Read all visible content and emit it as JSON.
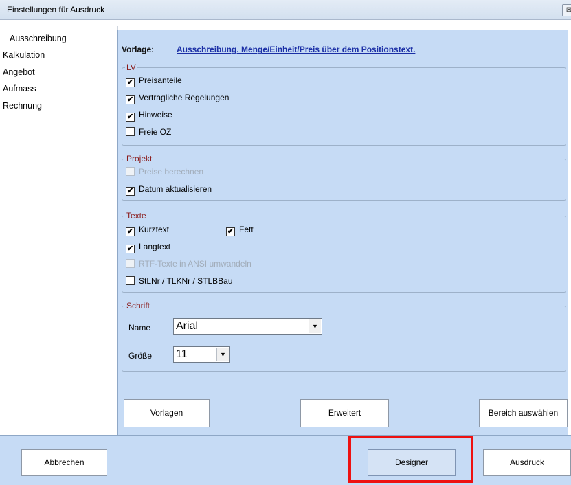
{
  "window": {
    "title": "Einstellungen für Ausdruck",
    "close_glyph": "⊠"
  },
  "nav": {
    "items": [
      {
        "label": "Ausschreibung",
        "active": true
      },
      {
        "label": "Kalkulation",
        "active": false
      },
      {
        "label": "Angebot",
        "active": false
      },
      {
        "label": "Aufmass",
        "active": false
      },
      {
        "label": "Rechnung",
        "active": false
      }
    ]
  },
  "vorlage": {
    "label": "Vorlage:",
    "link": "Ausschreibung. Menge/Einheit/Preis über dem Positionstext."
  },
  "groups": {
    "lv": {
      "title": "LV",
      "items": [
        {
          "label": "Preisanteile",
          "checked": true
        },
        {
          "label": "Vertragliche Regelungen",
          "checked": true
        },
        {
          "label": "Hinweise",
          "checked": true
        },
        {
          "label": "Freie OZ",
          "checked": false
        }
      ]
    },
    "projekt": {
      "title": "Projekt",
      "items": [
        {
          "label": "Preise berechnen",
          "checked": false,
          "disabled": true
        },
        {
          "label": "Datum aktualisieren",
          "checked": true
        }
      ]
    },
    "texte": {
      "title": "Texte",
      "items": [
        {
          "label": "Kurztext",
          "checked": true
        },
        {
          "label": "Fett",
          "checked": true
        },
        {
          "label": "Langtext",
          "checked": true
        },
        {
          "label": "RTF-Texte in ANSI umwandeln",
          "checked": false,
          "disabled": true
        },
        {
          "label": "StLNr / TLKNr / STLBBau",
          "checked": false
        }
      ]
    },
    "schrift": {
      "title": "Schrift",
      "name_label": "Name",
      "name_value": "Arial",
      "size_label": "Größe",
      "size_value": "11"
    }
  },
  "buttons": {
    "vorlagen": "Vorlagen",
    "erweitert": "Erweitert",
    "bereich": "Bereich auswählen",
    "abbrechen": "Abbrechen",
    "designer": "Designer",
    "ausdruck": "Ausdruck"
  },
  "colors": {
    "panel_bg": "#c6dbf5",
    "link": "#1b2fa6",
    "group_title": "#8a1a1a",
    "highlight": "#ee1111"
  }
}
